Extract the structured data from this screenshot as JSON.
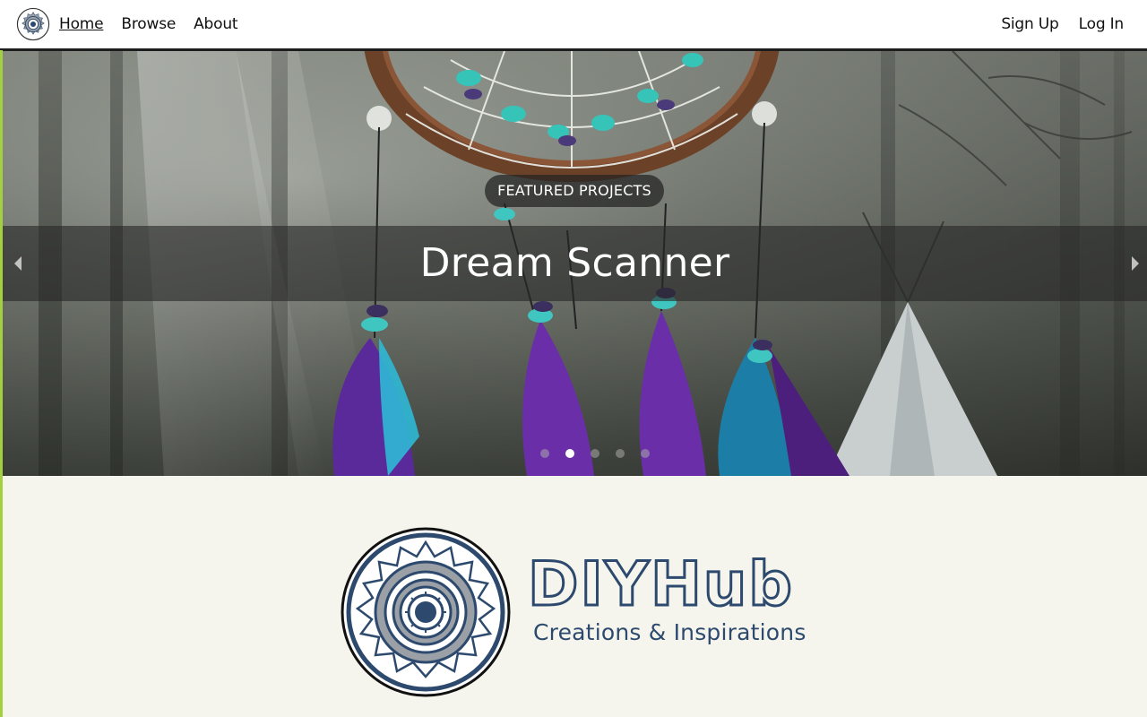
{
  "nav": {
    "logo_icon": "gear-logo-icon",
    "links": [
      {
        "label": "Home",
        "active": true
      },
      {
        "label": "Browse",
        "active": false
      },
      {
        "label": "About",
        "active": false
      }
    ],
    "right_links": [
      {
        "label": "Sign Up"
      },
      {
        "label": "Log In"
      }
    ]
  },
  "carousel": {
    "badge": "FEATURED PROJECTS",
    "title": "Dream Scanner",
    "prev_icon": "chevron-left-icon",
    "next_icon": "chevron-right-icon",
    "slide_count": 5,
    "active_slide": 2
  },
  "brand": {
    "name": "DIYHub",
    "tagline": "Creations & Inspirations",
    "color": "#2d4a6e"
  },
  "colors": {
    "accent": "#a4cf3e",
    "page_background": "#f5f5ed"
  }
}
